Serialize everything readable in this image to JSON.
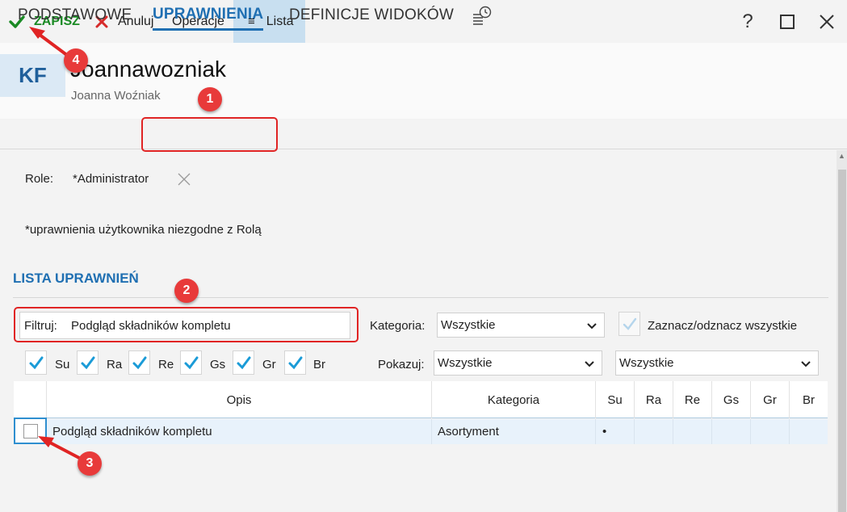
{
  "toolbar": {
    "save_label": "ZAPISZ",
    "cancel_label": "Anuluj",
    "operations_label": "Operacje",
    "list_label": "Lista",
    "list_icon": "≡",
    "help": "?"
  },
  "header": {
    "avatar": "KF",
    "login": "Joannawozniak",
    "full_name": "Joanna Woźniak"
  },
  "tabs": {
    "basic": "PODSTAWOWE",
    "permissions": "UPRAWNIENIA",
    "view_definitions": "DEFINICJE WIDOKÓW"
  },
  "roles": {
    "label": "Role:",
    "value": "*Administrator"
  },
  "note": "*uprawnienia użytkownika niezgodne z Rolą",
  "permissions": {
    "title": "LISTA UPRAWNIEŃ",
    "filter_label": "Filtruj:",
    "filter_value": "Podgląd składników kompletu",
    "category_label": "Kategoria:",
    "category_value": "Wszystkie",
    "select_all_label": "Zaznacz/odznacz wszystkie",
    "show_label": "Pokazuj:",
    "show_value": "Wszystkie",
    "show_value2": "Wszystkie",
    "flags": [
      "Su",
      "Ra",
      "Re",
      "Gs",
      "Gr",
      "Br"
    ]
  },
  "grid": {
    "columns": [
      "Opis",
      "Kategoria",
      "Su",
      "Ra",
      "Re",
      "Gs",
      "Gr",
      "Br"
    ],
    "rows": [
      {
        "opis": "Podgląd składników kompletu",
        "kategoria": "Asortyment",
        "su": "•",
        "ra": "",
        "re": "",
        "gs": "",
        "gr": "",
        "br": ""
      }
    ]
  },
  "annotations": [
    "1",
    "2",
    "3",
    "4"
  ],
  "colors": {
    "accent": "#1f6fb2",
    "save_green": "#1a8a24",
    "cancel_red": "#d62b2b",
    "annotation_red": "#e02424",
    "check_blue": "#1a9bd7"
  }
}
